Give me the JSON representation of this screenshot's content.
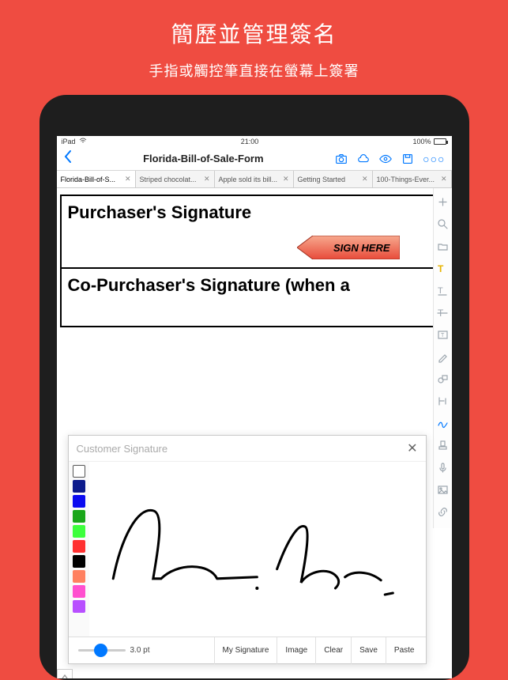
{
  "promo": {
    "title": "簡歷並管理簽名",
    "subtitle": "手指或觸控筆直接在螢幕上簽署"
  },
  "status": {
    "device": "iPad",
    "wifi_icon": "wifi-icon",
    "time": "21:00",
    "battery_pct": "100%"
  },
  "nav": {
    "back_icon": "chevron-left-icon",
    "title": "Florida-Bill-of-Sale-Form",
    "icons": [
      "camera-icon",
      "cloud-icon",
      "eye-icon",
      "save-icon",
      "more-icon"
    ]
  },
  "tabs": [
    {
      "label": "Florida-Bill-of-S...",
      "active": true
    },
    {
      "label": "Striped chocolat...",
      "active": false
    },
    {
      "label": "Apple sold its bill...",
      "active": false
    },
    {
      "label": "Getting Started",
      "active": false
    },
    {
      "label": "100-Things-Ever...",
      "active": false
    }
  ],
  "document": {
    "row1_label": "Purchaser's Signature",
    "row2_label": "Co-Purchaser's Signature (when a",
    "sign_here_text": "SIGN HERE"
  },
  "right_tools": [
    {
      "name": "add-icon"
    },
    {
      "name": "search-icon"
    },
    {
      "name": "folder-icon"
    },
    {
      "name": "highlight-icon",
      "state": "hl"
    },
    {
      "name": "underline-icon"
    },
    {
      "name": "strike-icon"
    },
    {
      "name": "text-box-icon"
    },
    {
      "name": "pencil-icon"
    },
    {
      "name": "shape-icon"
    },
    {
      "name": "insert-text-icon"
    },
    {
      "name": "signature-icon",
      "state": "active"
    },
    {
      "name": "stamp-icon"
    },
    {
      "name": "mic-icon"
    },
    {
      "name": "image-icon"
    },
    {
      "name": "link-icon"
    }
  ],
  "sig_panel": {
    "title": "Customer Signature",
    "close_icon": "close-icon",
    "colors": [
      "#ffffff",
      "#0b1a8c",
      "#0a0af0",
      "#19a619",
      "#3cff3c",
      "#ff3030",
      "#000000",
      "#ff8060",
      "#ff4fcf",
      "#b84fff"
    ],
    "thickness_label": "3.0 pt",
    "buttons": [
      "My Signature",
      "Image",
      "Clear",
      "Save",
      "Paste"
    ]
  }
}
